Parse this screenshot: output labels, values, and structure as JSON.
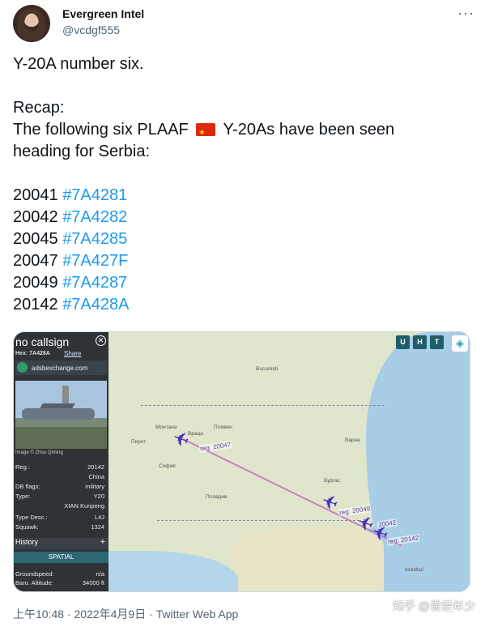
{
  "author": {
    "name": "Evergreen Intel",
    "handle": "@vcdgf555",
    "more_icon": "more-horizontal-icon"
  },
  "tweet": {
    "line1": "Y-20A number six.",
    "recap": "Recap:",
    "sentence_a": "The following six PLAAF",
    "sentence_b": "Y-20As have been seen",
    "sentence_c": "heading for Serbia:",
    "flag_icon": "china-flag-icon",
    "aircraft": [
      {
        "reg": "20041",
        "hex": "#7A4281"
      },
      {
        "reg": "20042",
        "hex": "#7A4282"
      },
      {
        "reg": "20045",
        "hex": "#7A4285"
      },
      {
        "reg": "20047",
        "hex": "#7A427F"
      },
      {
        "reg": "20049",
        "hex": "#7A4287"
      },
      {
        "reg": "20142",
        "hex": "#7A428A"
      }
    ],
    "hashtag_color": "#1d9bf0"
  },
  "media": {
    "panel": {
      "callsign": "no callsign",
      "hex_label": "Hex:",
      "hex_value": "7A428A",
      "share": "Share",
      "site": "adsbexchange.com",
      "credit": "Image © Zhou Qiming",
      "fields": [
        {
          "label": "Reg.:",
          "value": "20142"
        },
        {
          "label": "",
          "value": "China"
        },
        {
          "label": "DB flags:",
          "value": "military"
        },
        {
          "label": "Type:",
          "value": "Y20"
        },
        {
          "label": "",
          "value": "XIAN Kunpeng"
        },
        {
          "label": "Type Desc.:",
          "value": "L4J"
        },
        {
          "label": "Squawk:",
          "value": "1324"
        }
      ],
      "history": "History",
      "spatial": "SPATIAL",
      "groundspeed_label": "Groundspeed:",
      "groundspeed_value": "n/a",
      "altitude_label": "Baro. Altitude:",
      "altitude_value": "34000 ft"
    },
    "map": {
      "buttons": [
        "U",
        "H",
        "T"
      ],
      "planes": [
        {
          "label": "reg: 20047"
        },
        {
          "label": "reg: 20049"
        },
        {
          "label": "20042"
        },
        {
          "label": "reg: 20142"
        }
      ],
      "cities": [
        "București",
        "Плевен",
        "Варна",
        "София",
        "Бургас",
        "Пловдив",
        "Istanbul",
        "Пирот",
        "Монтана",
        "Враца"
      ],
      "plane_color": "#4a2fb5"
    }
  },
  "footer": {
    "meta": "上午10:48 · 2022年4月9日 · Twitter Web App",
    "watermark": "知乎 @曾经年少"
  }
}
